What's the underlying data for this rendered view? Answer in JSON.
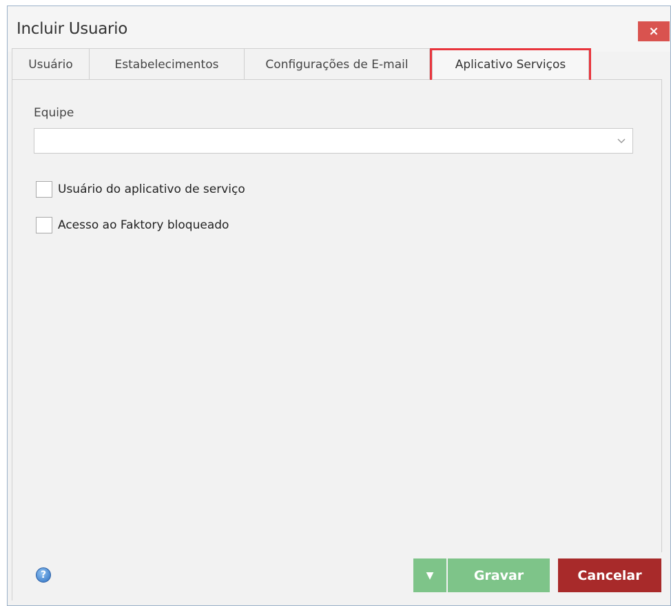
{
  "window": {
    "title": "Incluir Usuario",
    "close_label": "×"
  },
  "tabs": [
    {
      "label": "Usuário",
      "active": false
    },
    {
      "label": "Estabelecimentos",
      "active": false
    },
    {
      "label": "Configurações de E-mail",
      "active": false
    },
    {
      "label": "Aplicativo Serviços",
      "active": true
    }
  ],
  "form": {
    "team_label": "Equipe",
    "team_value": "",
    "team_arrow": "chevron-down-icon",
    "checkboxes": [
      {
        "label": "Usuário do aplicativo de serviço",
        "checked": false
      },
      {
        "label": "Acesso ao Faktory bloqueado",
        "checked": false
      }
    ]
  },
  "footer": {
    "help_icon": "help-icon",
    "help_glyph": "?",
    "dropdown_glyph": "▼",
    "save_label": "Gravar",
    "cancel_label": "Cancelar"
  },
  "colors": {
    "highlight": "#e8343c",
    "save": "#7ec489",
    "cancel": "#a82a2a",
    "close": "#d9534f"
  }
}
